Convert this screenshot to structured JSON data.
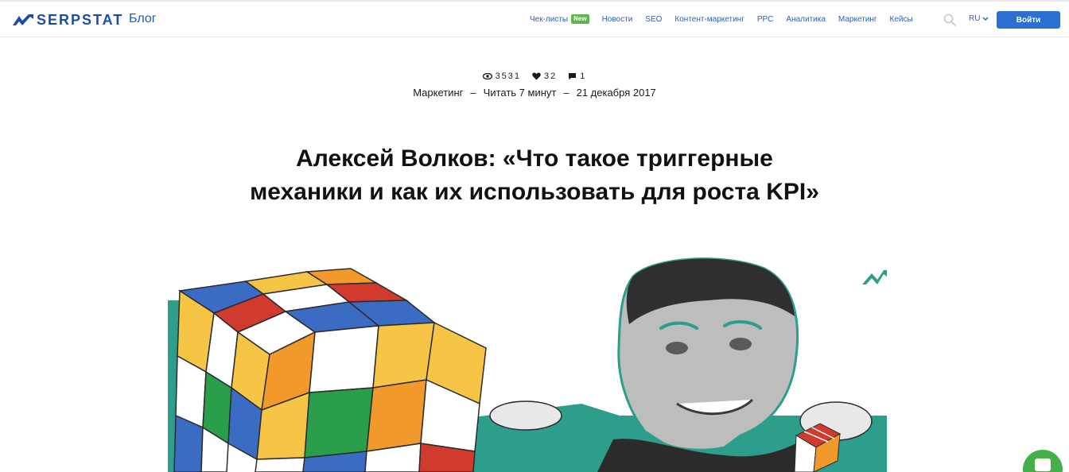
{
  "header": {
    "brand": "SERPSTAT",
    "blog_label": "Блог",
    "nav": [
      {
        "label": "Чек-листы",
        "badge": "New"
      },
      {
        "label": "Новости"
      },
      {
        "label": "SEO"
      },
      {
        "label": "Контент-маркетинг"
      },
      {
        "label": "PPC"
      },
      {
        "label": "Аналитика"
      },
      {
        "label": "Маркетинг"
      },
      {
        "label": "Кейсы"
      }
    ],
    "language": "RU",
    "login_label": "Войти",
    "icons": {
      "search": "search-icon",
      "lang_dropdown": "chevron-down-icon"
    }
  },
  "article": {
    "stats": {
      "views": "3531",
      "likes": "32",
      "comments": "1"
    },
    "category": "Маркетинг",
    "sep": "–",
    "read_time": "Читать 7 минут",
    "date": "21 декабря 2017",
    "title_line1": "Алексей Волков: «Что такое триггерные",
    "title_line2": "механики и как их использовать для роста KPI»"
  },
  "colors": {
    "brand_blue": "#1e4da0",
    "link_blue": "#2c5fb6",
    "button_blue": "#2b6fd3",
    "badge_green": "#60b44f",
    "teal": "#2e9e8c",
    "chat_green": "#43b04a"
  }
}
